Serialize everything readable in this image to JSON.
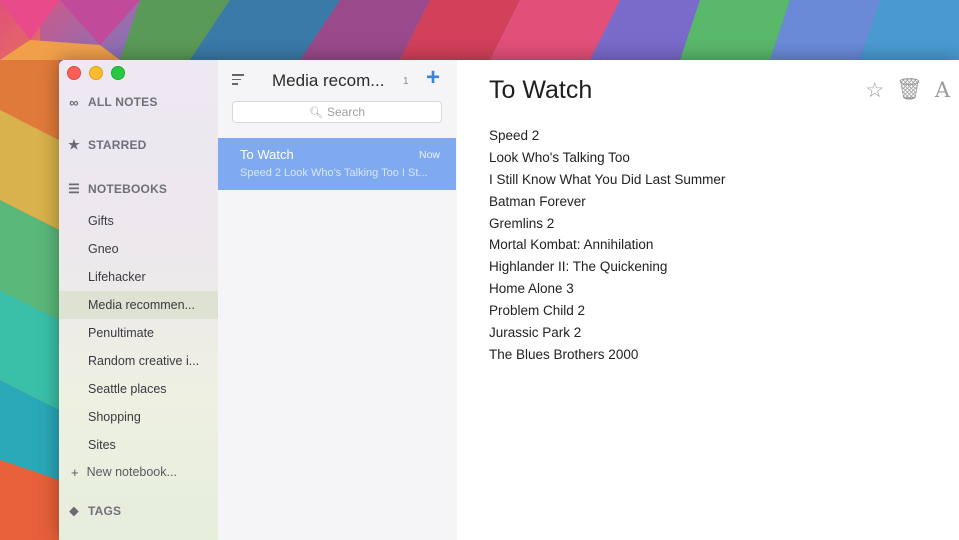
{
  "sidebar": {
    "all_notes_label": "ALL NOTES",
    "starred_label": "STARRED",
    "notebooks_label": "NOTEBOOKS",
    "notebooks": [
      {
        "label": "Gifts",
        "selected": false
      },
      {
        "label": "Gneo",
        "selected": false
      },
      {
        "label": "Lifehacker",
        "selected": false
      },
      {
        "label": "Media recommen...",
        "selected": true
      },
      {
        "label": "Penultimate",
        "selected": false
      },
      {
        "label": "Random creative i...",
        "selected": false
      },
      {
        "label": "Seattle places",
        "selected": false
      },
      {
        "label": "Shopping",
        "selected": false
      },
      {
        "label": "Sites",
        "selected": false
      }
    ],
    "new_notebook_label": "New notebook...",
    "tags_label": "TAGS"
  },
  "note_list": {
    "title": "Media recom...",
    "count": "1",
    "search_placeholder": "Search",
    "notes": [
      {
        "title": "To Watch",
        "time": "Now",
        "snippet": "Speed 2 Look Who's Talking Too I St..."
      }
    ]
  },
  "editor": {
    "title": "To Watch",
    "lines": [
      "Speed 2",
      "Look Who's Talking Too",
      "I Still Know What You Did Last Summer",
      "Batman Forever",
      "Gremlins 2",
      "Mortal Kombat: Annihilation",
      "Highlander II: The Quickening",
      "Home Alone 3",
      "Problem Child 2",
      "Jurassic Park 2",
      "The Blues Brothers 2000"
    ]
  },
  "colors": {
    "accent": "#3b82e0",
    "selected_note": "#7faaf0",
    "selected_notebook": "#dde2d2"
  }
}
